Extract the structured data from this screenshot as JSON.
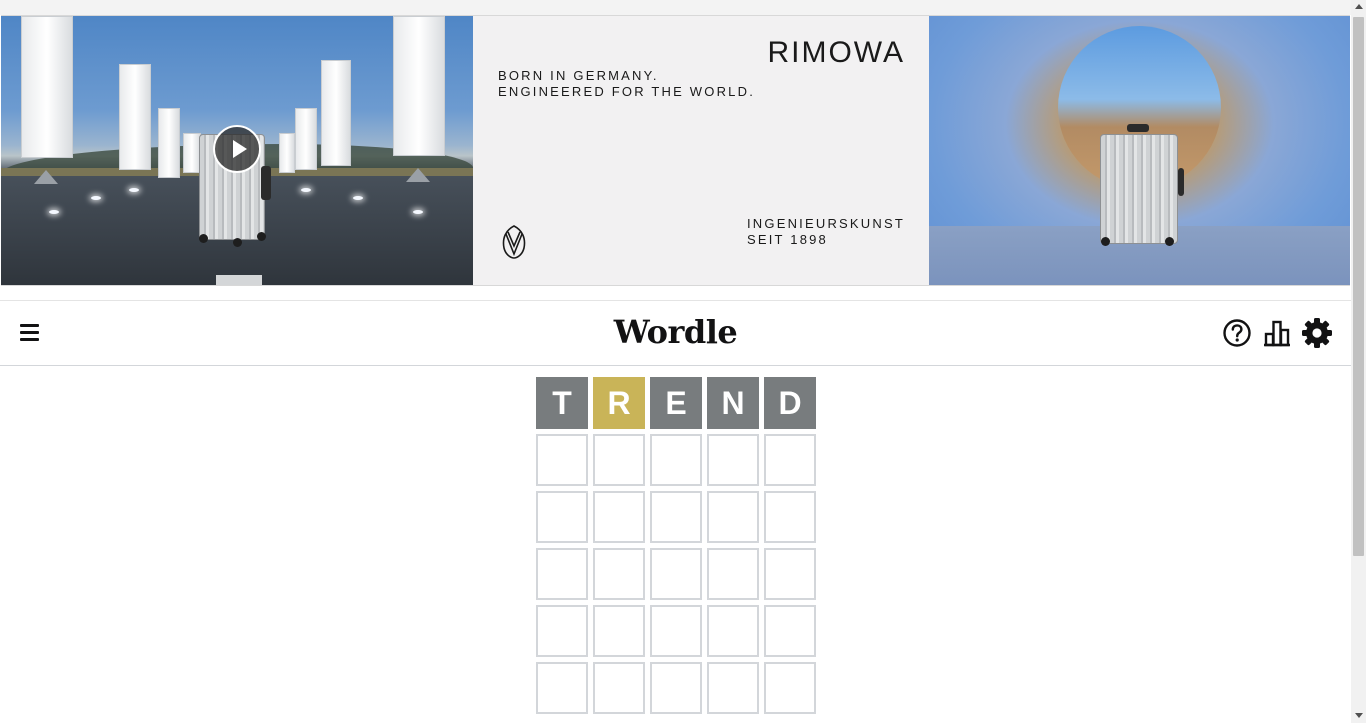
{
  "ad": {
    "brand": "RIMOWA",
    "tagline_line1": "BORN IN GERMANY.",
    "tagline_line2": "ENGINEERED FOR THE WORLD.",
    "since_line1": "INGENIEURSKUNST",
    "since_line2": "SEIT 1898"
  },
  "header": {
    "title": "Wordle",
    "icons": [
      "menu-icon",
      "help-icon",
      "statistics-icon",
      "settings-icon"
    ]
  },
  "board": {
    "rows": [
      [
        {
          "letter": "T",
          "state": "absent"
        },
        {
          "letter": "R",
          "state": "present"
        },
        {
          "letter": "E",
          "state": "absent"
        },
        {
          "letter": "N",
          "state": "absent"
        },
        {
          "letter": "D",
          "state": "absent"
        }
      ],
      [
        {
          "letter": "",
          "state": "empty"
        },
        {
          "letter": "",
          "state": "empty"
        },
        {
          "letter": "",
          "state": "empty"
        },
        {
          "letter": "",
          "state": "empty"
        },
        {
          "letter": "",
          "state": "empty"
        }
      ],
      [
        {
          "letter": "",
          "state": "empty"
        },
        {
          "letter": "",
          "state": "empty"
        },
        {
          "letter": "",
          "state": "empty"
        },
        {
          "letter": "",
          "state": "empty"
        },
        {
          "letter": "",
          "state": "empty"
        }
      ],
      [
        {
          "letter": "",
          "state": "empty"
        },
        {
          "letter": "",
          "state": "empty"
        },
        {
          "letter": "",
          "state": "empty"
        },
        {
          "letter": "",
          "state": "empty"
        },
        {
          "letter": "",
          "state": "empty"
        }
      ],
      [
        {
          "letter": "",
          "state": "empty"
        },
        {
          "letter": "",
          "state": "empty"
        },
        {
          "letter": "",
          "state": "empty"
        },
        {
          "letter": "",
          "state": "empty"
        },
        {
          "letter": "",
          "state": "empty"
        }
      ],
      [
        {
          "letter": "",
          "state": "empty"
        },
        {
          "letter": "",
          "state": "empty"
        },
        {
          "letter": "",
          "state": "empty"
        },
        {
          "letter": "",
          "state": "empty"
        },
        {
          "letter": "",
          "state": "empty"
        }
      ]
    ]
  },
  "colors": {
    "absent": "#787c7e",
    "present": "#c9b458",
    "correct": "#6aaa64",
    "empty_border": "#d3d6da",
    "text": "#121213"
  }
}
